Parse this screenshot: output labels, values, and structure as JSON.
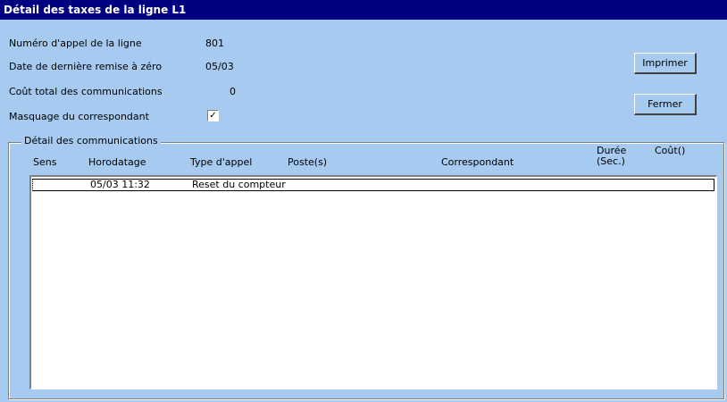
{
  "window": {
    "title": "Détail des taxes de la ligne L1"
  },
  "fields": {
    "numero_label": "Numéro d'appel de la ligne",
    "numero_value": "801",
    "date_label": "Date de dernière remise à zéro",
    "date_value": "05/03",
    "cout_label": "Coût total des communications",
    "cout_value": "0",
    "masquage_label": "Masquage du correspondant",
    "masquage_checked": true,
    "check_mark": "✓"
  },
  "buttons": {
    "imprimer": "Imprimer",
    "fermer": "Fermer"
  },
  "group": {
    "title": "Détail des communications"
  },
  "table": {
    "columns": {
      "sens": "Sens",
      "horodatage": "Horodatage",
      "type": "Type d'appel",
      "postes": "Poste(s)",
      "correspondant": "Correspondant",
      "duree_line1": "Durée",
      "duree_line2": "(Sec.)",
      "cout": "Coût()"
    },
    "rows": [
      {
        "sens": "",
        "horodatage": "05/03 11:32",
        "type": "Reset du compteur",
        "postes": "",
        "correspondant": "",
        "duree": "",
        "cout": ""
      }
    ]
  }
}
